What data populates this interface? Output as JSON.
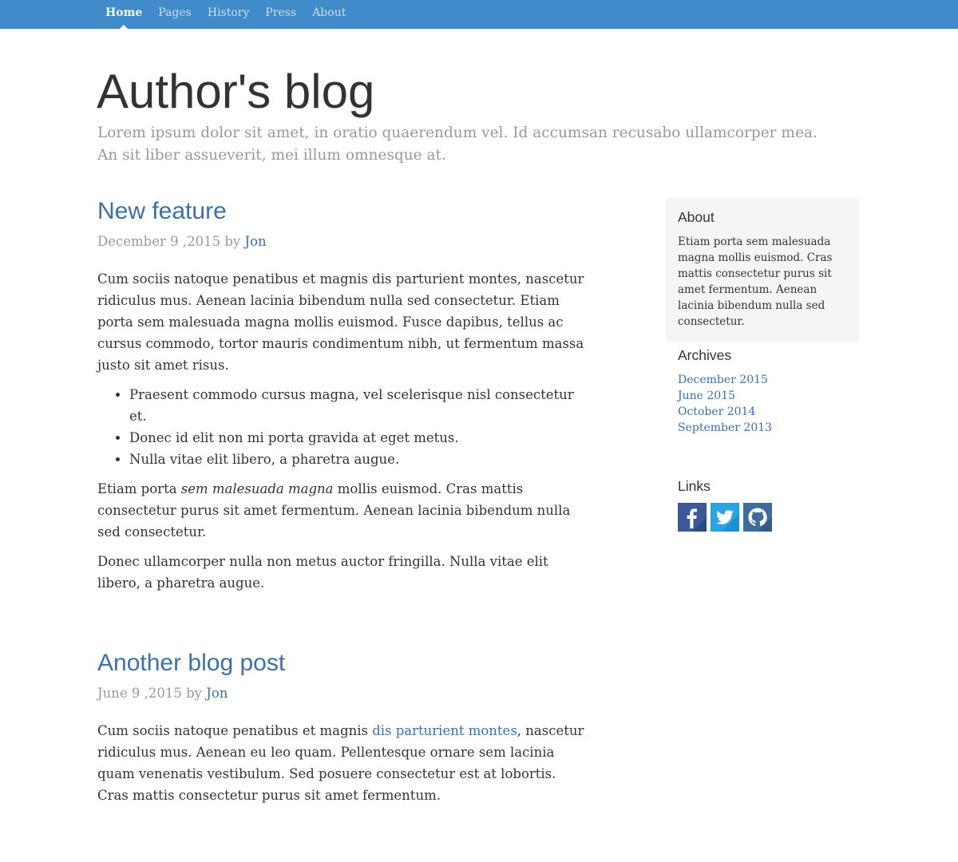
{
  "nav": {
    "items": [
      {
        "label": "Home",
        "active": true
      },
      {
        "label": "Pages",
        "active": false
      },
      {
        "label": "History",
        "active": false
      },
      {
        "label": "Press",
        "active": false
      },
      {
        "label": "About",
        "active": false
      }
    ]
  },
  "header": {
    "title": "Author's blog",
    "description": "Lorem ipsum dolor sit amet, in oratio quaerendum vel. Id accumsan recusabo ullamcorper mea. An sit liber assueverit, mei illum omnesque at."
  },
  "posts": [
    {
      "title": "New feature",
      "date": "December 9 ,2015 by",
      "author": "Jon",
      "p1": "Cum sociis natoque penatibus et magnis dis parturient montes, nascetur ridiculus mus. Aenean lacinia bibendum nulla sed consectetur. Etiam porta sem malesuada magna mollis euismod. Fusce dapibus, tellus ac cursus commodo, tortor mauris condimentum nibh, ut fermentum massa justo sit amet risus.",
      "list": [
        "Praesent commodo cursus magna, vel scelerisque nisl consectetur et.",
        "Donec id elit non mi porta gravida at eget metus.",
        "Nulla vitae elit libero, a pharetra augue."
      ],
      "p2_before": "Etiam porta ",
      "p2_em": "sem malesuada magna",
      "p2_after": " mollis euismod. Cras mattis consectetur purus sit amet fermentum. Aenean lacinia bibendum nulla sed consectetur.",
      "p3": "Donec ullamcorper nulla non metus auctor fringilla. Nulla vitae elit libero, a pharetra augue."
    },
    {
      "title": "Another blog post",
      "date": "June 9 ,2015 by",
      "author": "Jon",
      "p1_before": "Cum sociis natoque penatibus et magnis ",
      "p1_link": "dis parturient montes",
      "p1_after": ", nascetur ridiculus mus. Aenean eu leo quam. Pellentesque ornare sem lacinia quam venenatis vestibulum. Sed posuere consectetur est at lobortis. Cras mattis consectetur purus sit amet fermentum."
    }
  ],
  "sidebar": {
    "about": {
      "heading": "About",
      "text": "Etiam porta sem malesuada magna mollis euismod. Cras mattis consectetur purus sit amet fermentum. Aenean lacinia bibendum nulla sed consectetur."
    },
    "archives": {
      "heading": "Archives",
      "items": [
        "December 2015",
        "June 2015",
        "October 2014",
        "September 2013"
      ]
    },
    "links": {
      "heading": "Links",
      "icons": [
        {
          "name": "facebook-icon",
          "color": "#3b5998"
        },
        {
          "name": "twitter-icon",
          "color": "#29a3e6"
        },
        {
          "name": "github-icon",
          "color": "#3f6d9b"
        }
      ]
    }
  },
  "colors": {
    "navbar": "#428bca",
    "link": "#3a70ac",
    "muted": "#999999",
    "text": "#333333",
    "sidebar_bg": "#f5f5f5"
  }
}
